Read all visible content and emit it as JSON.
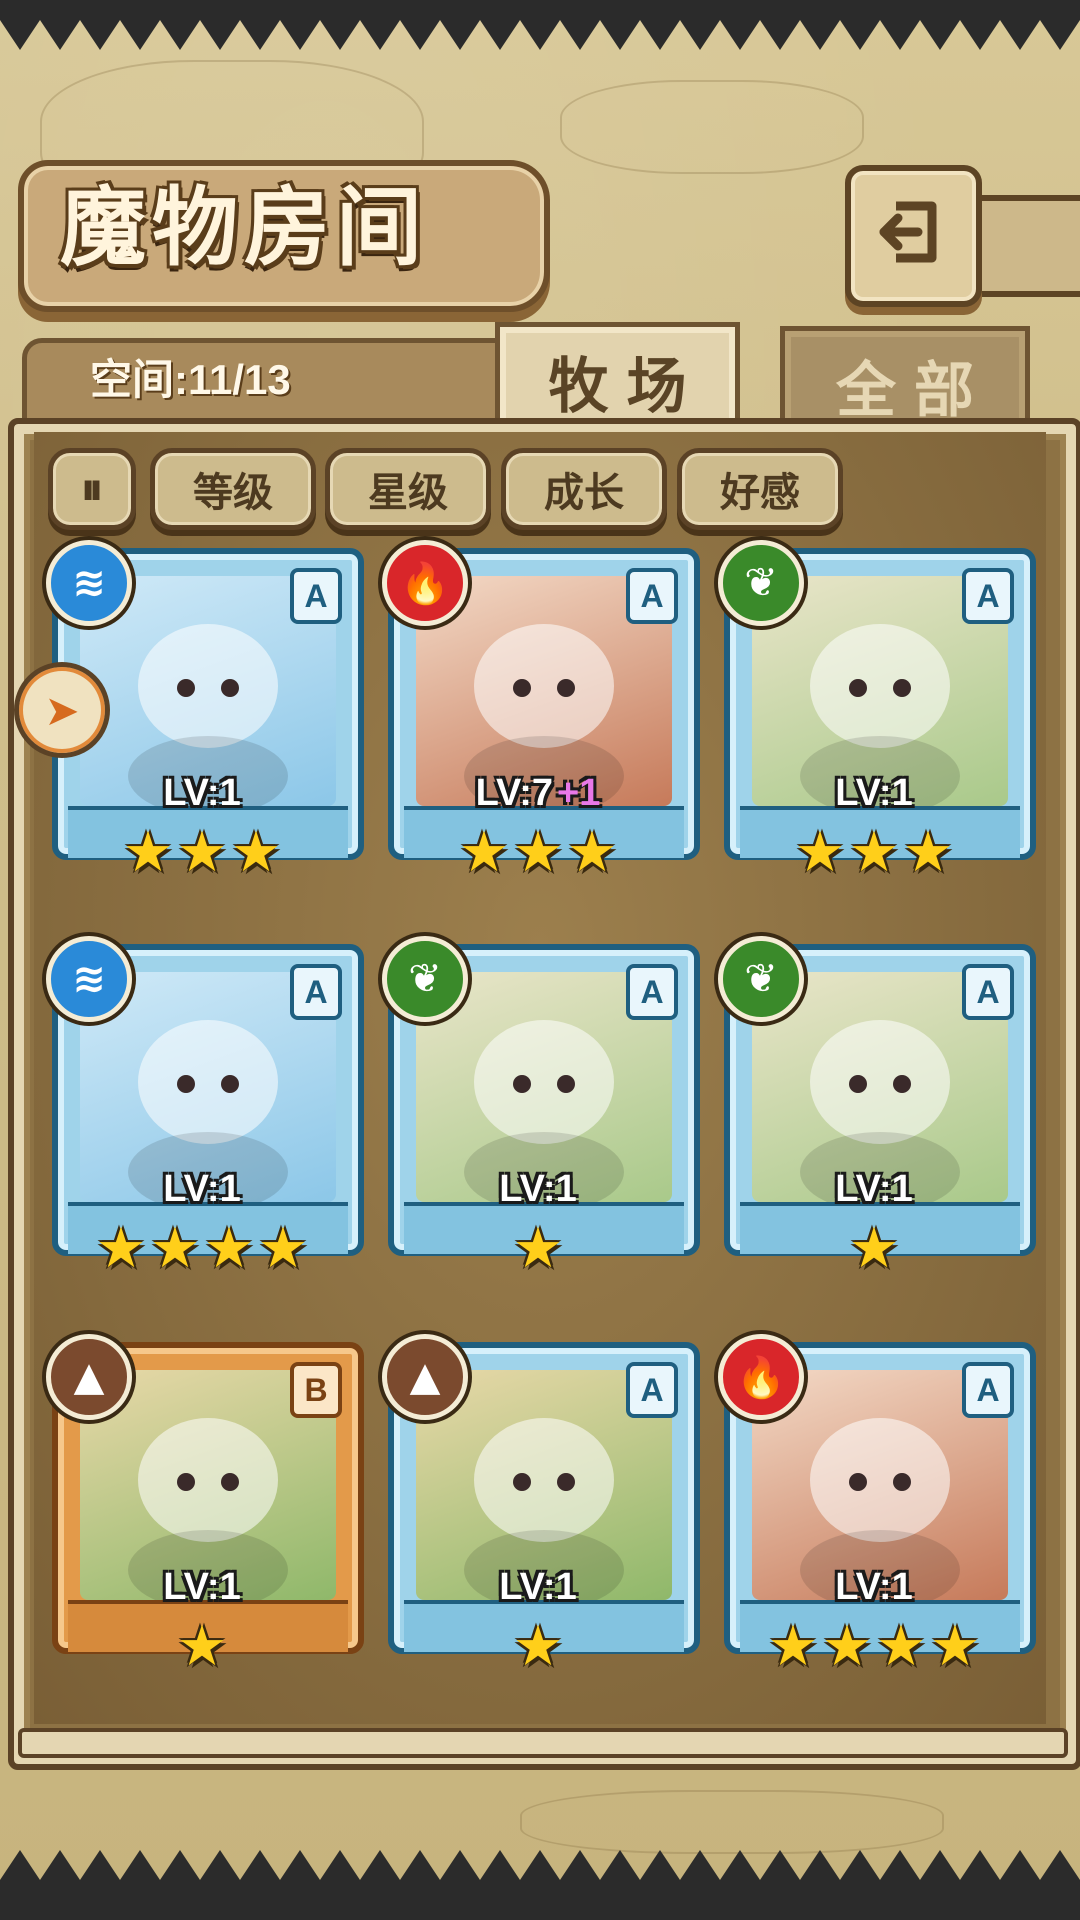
{
  "header": {
    "title": "魔物房间",
    "back_icon": "back-arrow-icon"
  },
  "tabs": {
    "space_label": "空间:11/13",
    "ranch": "牧场",
    "all": "全部"
  },
  "sort": {
    "toggle": "⏸",
    "level": "等级",
    "star": "星级",
    "growth": "成长",
    "affection": "好感"
  },
  "cards": [
    {
      "element": "water",
      "element_icon": "water-wave-icon",
      "rank": "A",
      "level": "LV:1",
      "bonus": "",
      "stars": 3,
      "frame": "blue"
    },
    {
      "element": "fire",
      "element_icon": "flame-icon",
      "rank": "A",
      "level": "LV:7",
      "bonus": "+1",
      "stars": 3,
      "frame": "blue"
    },
    {
      "element": "wood",
      "element_icon": "leaf-icon",
      "rank": "A",
      "level": "LV:1",
      "bonus": "",
      "stars": 3,
      "frame": "blue"
    },
    {
      "element": "water",
      "element_icon": "water-wave-icon",
      "rank": "A",
      "level": "LV:1",
      "bonus": "",
      "stars": 4,
      "frame": "blue"
    },
    {
      "element": "wood",
      "element_icon": "leaf-icon",
      "rank": "A",
      "level": "LV:1",
      "bonus": "",
      "stars": 1,
      "frame": "blue"
    },
    {
      "element": "wood",
      "element_icon": "leaf-icon",
      "rank": "A",
      "level": "LV:1",
      "bonus": "",
      "stars": 1,
      "frame": "blue"
    },
    {
      "element": "earth",
      "element_icon": "mountain-icon",
      "rank": "B",
      "level": "LV:1",
      "bonus": "",
      "stars": 1,
      "frame": "bronze"
    },
    {
      "element": "earth",
      "element_icon": "mountain-icon",
      "rank": "A",
      "level": "LV:1",
      "bonus": "",
      "stars": 1,
      "frame": "blue"
    },
    {
      "element": "fire",
      "element_icon": "flame-icon",
      "rank": "A",
      "level": "LV:1",
      "bonus": "",
      "stars": 4,
      "frame": "blue"
    }
  ],
  "colors": {
    "water": "#2a8ad8",
    "fire": "#d9262a",
    "wood": "#3a8a2a",
    "earth": "#7b4a2e"
  }
}
